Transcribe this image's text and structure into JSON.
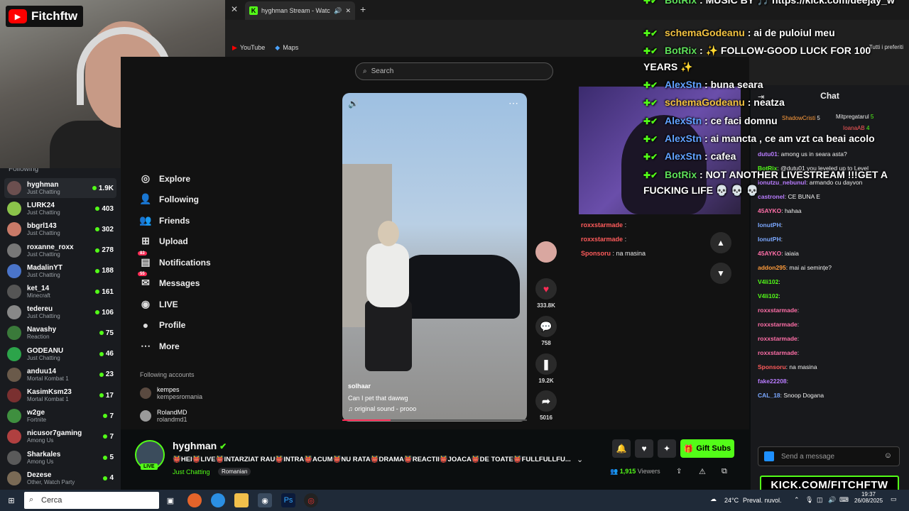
{
  "webcam": {
    "channel_label": "Fitchftw",
    "yt_glyph": "▶"
  },
  "browser": {
    "tab_title": "hyghman Stream - Watch L",
    "bookmarks": [
      {
        "label": "YouTube",
        "icon": "youtube-icon"
      },
      {
        "label": "Maps",
        "icon": "maps-icon"
      }
    ],
    "all_favorites": "Tutti i preferiti"
  },
  "tiktok": {
    "search_placeholder": "Search",
    "nav": [
      {
        "label": "Explore",
        "icon": "explore-icon"
      },
      {
        "label": "Following",
        "icon": "following-icon"
      },
      {
        "label": "Friends",
        "icon": "friends-icon"
      },
      {
        "label": "Upload",
        "icon": "upload-icon"
      },
      {
        "label": "Notifications",
        "icon": "notifications-icon",
        "badge": "83"
      },
      {
        "label": "Messages",
        "icon": "messages-icon",
        "badge": "55"
      },
      {
        "label": "LIVE",
        "icon": "live-icon"
      },
      {
        "label": "Profile",
        "icon": "profile-icon"
      },
      {
        "label": "More",
        "icon": "more-icon"
      }
    ],
    "following_accounts_header": "Following accounts",
    "following_accounts": [
      {
        "name": "kempes",
        "handle": "kempesromania"
      },
      {
        "name": "RolandMD",
        "handle": "rolandmd1"
      }
    ],
    "video": {
      "author": "solhaar",
      "caption": "Can I pet that dawwg",
      "sound": "♫ original sound - proоо",
      "progress": 0.26,
      "likes": "333.8K",
      "comments": "758",
      "saves": "19.2K",
      "shares": "5016"
    }
  },
  "sidebar": {
    "header": "Following",
    "items": [
      {
        "name": "hyghman",
        "category": "Just Chatting",
        "viewers": "1.9K"
      },
      {
        "name": "LURK24",
        "category": "Just Chatting",
        "viewers": "403"
      },
      {
        "name": "bbgrl143",
        "category": "Just Chatting",
        "viewers": "302"
      },
      {
        "name": "roxanne_roxx",
        "category": "Just Chatting",
        "viewers": "278"
      },
      {
        "name": "MadalinYT",
        "category": "Just Chatting",
        "viewers": "188"
      },
      {
        "name": "ket_14",
        "category": "Minecraft",
        "viewers": "161"
      },
      {
        "name": "tedereu",
        "category": "Just Chatting",
        "viewers": "106"
      },
      {
        "name": "Navashy",
        "category": "Reaction",
        "viewers": "75"
      },
      {
        "name": "GODEANU",
        "category": "Just Chatting",
        "viewers": "46"
      },
      {
        "name": "anduu14",
        "category": "Mortal Kombat 1",
        "viewers": "23"
      },
      {
        "name": "KasimKsm23",
        "category": "Mortal Kombat 1",
        "viewers": "17"
      },
      {
        "name": "w2ge",
        "category": "Fortnite",
        "viewers": "7"
      },
      {
        "name": "nicusor7gaming",
        "category": "Among Us",
        "viewers": "7"
      },
      {
        "name": "Sharkales",
        "category": "Among Us",
        "viewers": "5"
      },
      {
        "name": "Dezese",
        "category": "Other, Watch Party",
        "viewers": "4"
      }
    ]
  },
  "overlay_chat": [
    {
      "user": "BotRix",
      "text": " : MUSIC BY 🎵 https://kick.com/deejay_w"
    },
    {
      "user": "schemaGodeanu",
      "text": " : ai de puloiul meu"
    },
    {
      "user": "BotRix",
      "text": " : ✨ FOLLOW-GOOD LUCK FOR 100"
    },
    {
      "user": "",
      "text": "YEARS ✨"
    },
    {
      "user": "AlexStn",
      "text": " : buna seara"
    },
    {
      "user": "schemaGodeanu",
      "text": " : neatza"
    },
    {
      "user": "AlexStn",
      "text": " : ce faci domnu"
    },
    {
      "user": "AlexStn",
      "text": " : ai mancta , ce am vzt ca beai acolo"
    },
    {
      "user": "AlexStn",
      "text": " : cafea"
    },
    {
      "user": "BotRix",
      "text": " : NOT ANOTHER LIVESTREAM !!!GET A"
    },
    {
      "user": "",
      "text": "FUCKING LIFE 💀 💀 💀"
    }
  ],
  "kick_chat": {
    "title": "Chat",
    "top_gifters": [
      {
        "name": "ShadowCristi",
        "count": "5"
      },
      {
        "name": "Mitpregatarul",
        "count": "5"
      },
      {
        "name": "IoanaAB",
        "count": "4"
      }
    ],
    "messages": [
      {
        "user": "dutu01",
        "text": ": among us in seara asta?"
      },
      {
        "user": "BotRix",
        "text": ": @dutu01 you leveled up to Level"
      },
      {
        "user": "ionutzu_nebunul",
        "text": ": armando cu dayvon"
      },
      {
        "user": "castronel",
        "text": ": CE BUNA E"
      },
      {
        "user": "45AYKO",
        "text": ": hahaa"
      },
      {
        "user": "IonutPH",
        "text": ":"
      },
      {
        "user": "IonutPH",
        "text": ":"
      },
      {
        "user": "45AYKO",
        "text": ": iaiaia"
      },
      {
        "user": "addon295",
        "text": ": mai ai semințe?"
      },
      {
        "user": "V4li102",
        "text": ":"
      },
      {
        "user": "V4li102",
        "text": ":"
      },
      {
        "user": "roxxstarmade",
        "text": ":"
      },
      {
        "user": "roxxstarmade",
        "text": ":"
      },
      {
        "user": "roxxstarmade",
        "text": ":"
      },
      {
        "user": "roxxstarmade",
        "text": ":"
      },
      {
        "user": "Sponsoru",
        "text": ": na masina"
      },
      {
        "user": "fake22208",
        "text": ":"
      },
      {
        "user": "CAL_18",
        "text": ": Snoop Dogana"
      }
    ],
    "send_placeholder": "Send a message"
  },
  "mini_cam_chat": [
    {
      "user": "roxxstarmade",
      "text": ":"
    },
    {
      "user": "roxxstarmade",
      "text": ":"
    },
    {
      "user": "Sponsoru",
      "text": ": na masina"
    }
  ],
  "stream": {
    "channel": "hyghman",
    "live_label": "LIVE",
    "title": "👹HEI👹LIVE👹INTARZIAT RAU👹INTRA👹ACUM👹NU RATA👹DRAMA👹REACTII👹JOACA👹DE TOATE👹FULLFULLFU...",
    "category": "Just Chatting",
    "tag": "Romanian",
    "viewers": "1,915",
    "viewers_label": "Viewers",
    "gift_label": "Gift Subs"
  },
  "kick_logo": "KICK.COM/FITCHFTW",
  "taskbar": {
    "search_placeholder": "Cerca",
    "weather_temp": "24°C",
    "weather_text": "Preval. nuvol.",
    "time": "19:37",
    "date": "26/08/2025"
  },
  "colors": {
    "kick_green": "#53fc18",
    "tiktok_red": "#fe2c55",
    "panel_bg": "#18191c"
  }
}
